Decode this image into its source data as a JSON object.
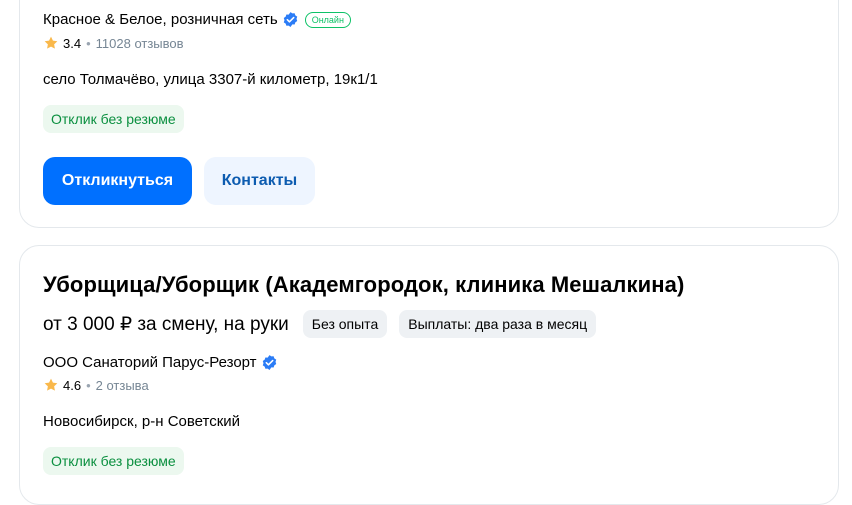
{
  "cards": [
    {
      "company": "Красное & Белое, розничная сеть",
      "online_badge": "Онлайн",
      "rating": "3.4",
      "reviews": "11028 отзывов",
      "address": "село Толмачёво, улица 3307-й километр, 19к1/1",
      "no_resume": "Отклик без резюме",
      "respond_label": "Откликнуться",
      "contacts_label": "Контакты"
    },
    {
      "title": "Уборщица/Уборщик (Академгородок, клиника Мешалкина)",
      "salary": "от 3 000 ₽ за смену, на руки",
      "chips": [
        "Без опыта",
        "Выплаты: два раза в месяц"
      ],
      "company": "ООО Санаторий Парус-Резорт",
      "rating": "4.6",
      "reviews": "2 отзыва",
      "address": "Новосибирск, р-н Советский",
      "no_resume": "Отклик без резюме"
    }
  ],
  "colors": {
    "accent": "#0070ff",
    "verified": "#2b7cf6",
    "online": "#0dc267",
    "star": "#f9b84b"
  },
  "icons": [
    "verified-check-icon",
    "star-icon"
  ]
}
